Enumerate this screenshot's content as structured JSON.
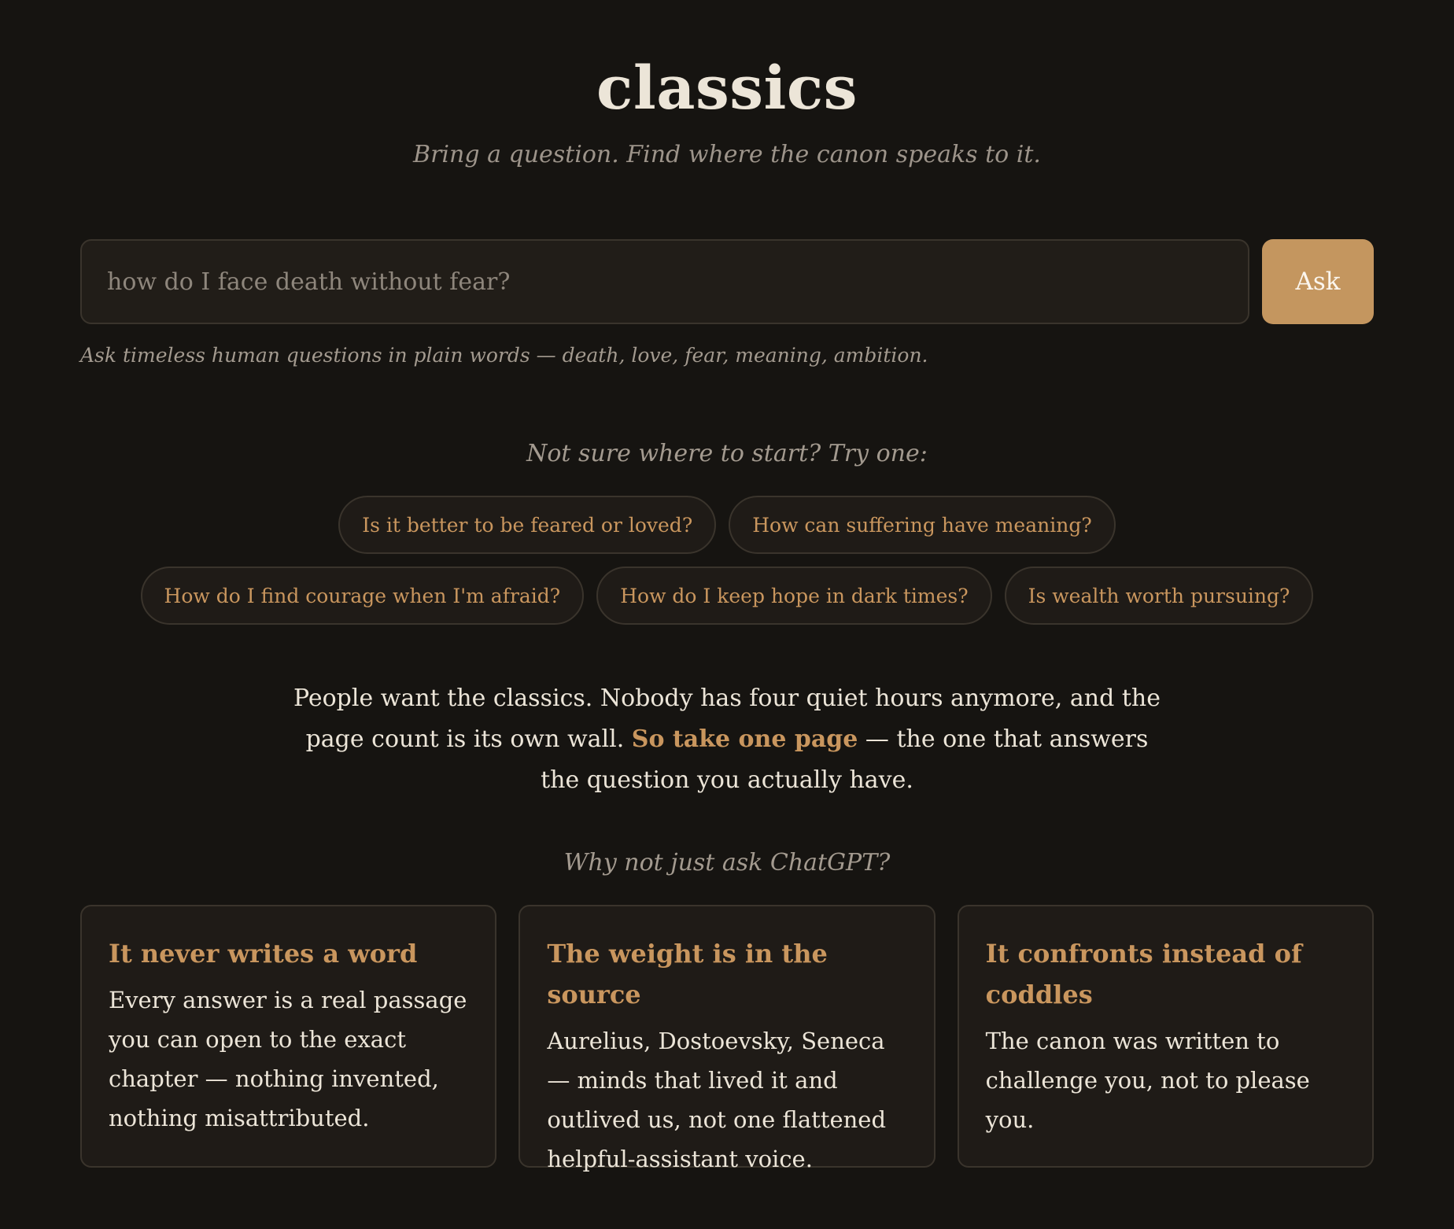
{
  "header": {
    "title": "classics",
    "tagline": "Bring a question. Find where the canon speaks to it."
  },
  "search": {
    "placeholder": "how do I face death without fear?",
    "value": "",
    "button_label": "Ask",
    "hint": "Ask timeless human questions in plain words — death, love, fear, meaning, ambition."
  },
  "suggestions": {
    "label": "Not sure where to start? Try one:",
    "items": [
      "Is it better to be feared or loved?",
      "How can suffering have meaning?",
      "How do I find courage when I'm afraid?",
      "How do I keep hope in dark times?",
      "Is wealth worth pursuing?"
    ]
  },
  "pitch": {
    "before": "People want the classics. Nobody has four quiet hours anymore, and the page count is its own wall. ",
    "emphasis": "So take one page",
    "after": " — the one that answers the question you actually have."
  },
  "why": {
    "label": "Why not just ask ChatGPT?",
    "cards": [
      {
        "title": "It never writes a word",
        "body": "Every answer is a real passage you can open to the exact chapter — nothing invented, nothing misattributed."
      },
      {
        "title": "The weight is in the source",
        "body": "Aurelius, Dostoevsky, Seneca — minds that lived it and outlived us, not one flattened helpful-assistant voice."
      },
      {
        "title": "It confronts instead of coddles",
        "body": "The canon was written to challenge you, not to please you."
      }
    ]
  },
  "colors": {
    "background": "#161411",
    "accent": "#c9965e",
    "button": "#c4965f",
    "text": "#ece5d8",
    "muted": "#a39a8f"
  }
}
